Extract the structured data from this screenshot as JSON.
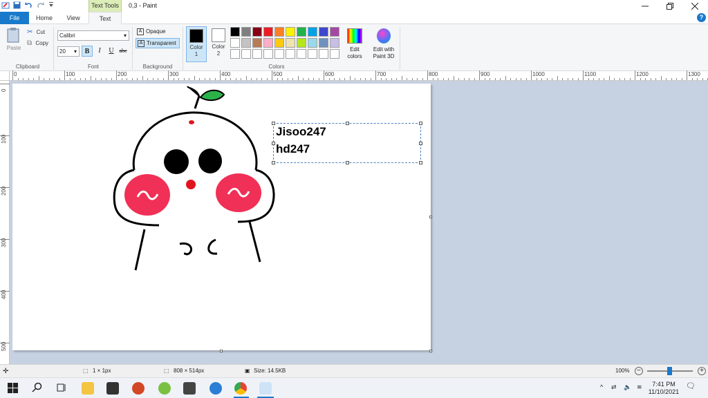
{
  "window": {
    "title": "0,3 - Paint",
    "context_tab_group": "Text Tools"
  },
  "tabs": [
    "File",
    "Home",
    "View",
    "Text"
  ],
  "ribbon": {
    "clipboard": {
      "paste": "Paste",
      "cut": "Cut",
      "copy": "Copy",
      "label": "Clipboard"
    },
    "font": {
      "family": "Calibri",
      "size": "20",
      "bold": "B",
      "italic": "I",
      "underline": "U",
      "strike": "abc",
      "label": "Font"
    },
    "background": {
      "opaque": "Opaque",
      "transparent": "Transparent",
      "label": "Background"
    },
    "color1": {
      "label": "Color",
      "index": "1",
      "value": "#000000"
    },
    "color2": {
      "label": "Color",
      "index": "2",
      "value": "#ffffff"
    },
    "colors_label": "Colors",
    "palette": [
      "#000000",
      "#7f7f7f",
      "#880015",
      "#ed1c24",
      "#ff7f27",
      "#fff200",
      "#22b14c",
      "#00a2e8",
      "#3f48cc",
      "#a349a4",
      "#ffffff",
      "#c3c3c3",
      "#b97a57",
      "#ffaec9",
      "#ffc90e",
      "#efe4b0",
      "#b5e61d",
      "#99d9ea",
      "#7092be",
      "#c8bfe7",
      "#ffffff",
      "#ffffff",
      "#ffffff",
      "#ffffff",
      "#ffffff",
      "#ffffff",
      "#ffffff",
      "#ffffff",
      "#ffffff",
      "#ffffff"
    ],
    "edit_colors": [
      "Edit",
      "colors"
    ],
    "edit_paint3d": [
      "Edit with",
      "Paint 3D"
    ]
  },
  "ruler": {
    "h": [
      "0",
      "100",
      "200",
      "300",
      "400",
      "500",
      "600",
      "700",
      "800",
      "900",
      "1000",
      "1100",
      "1200",
      "1300"
    ],
    "v": [
      "0",
      "100",
      "200",
      "300",
      "400",
      "500"
    ]
  },
  "canvas": {
    "text_lines": [
      "Jisoo247",
      "hd247"
    ],
    "drawing": "cute-character"
  },
  "status": {
    "cursor": "1 × 1px",
    "dimensions": "808 × 514px",
    "size": "Size: 14.5KB",
    "zoom": "100%"
  },
  "taskbar": {
    "time": "7:41 PM",
    "date": "11/10/2021"
  }
}
